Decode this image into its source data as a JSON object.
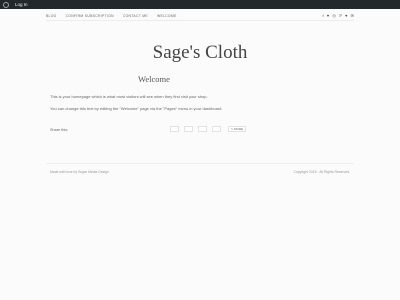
{
  "adminbar": {
    "login_label": "Log In"
  },
  "nav": {
    "items": [
      {
        "label": "BLOG"
      },
      {
        "label": "CONFIRM SUBSCRIPTION"
      },
      {
        "label": "CONTACT ME"
      },
      {
        "label": "WELCOME"
      }
    ],
    "social": [
      {
        "glyph": "f",
        "icon": "facebook-icon"
      },
      {
        "glyph": "♥",
        "icon": "twitter-icon"
      },
      {
        "glyph": "◎",
        "icon": "instagram-icon"
      },
      {
        "glyph": "ℙ",
        "icon": "pinterest-icon"
      },
      {
        "glyph": "♥",
        "icon": "bloglovin-icon"
      },
      {
        "glyph": "✉",
        "icon": "email-icon"
      }
    ]
  },
  "site": {
    "title": "Sage's Cloth"
  },
  "page": {
    "title": "Welcome",
    "paragraphs": [
      "This is your homepage which is what most visitors will see when they first visit your shop.",
      "You can change this text by editing the \"Welcome\" page via the \"Pages\" menu in your dashboard."
    ]
  },
  "share": {
    "label": "Share this:",
    "more_label": "MORE",
    "more_icon": "share-icon"
  },
  "footer": {
    "made_prefix": "Made with love by",
    "made_link": "Sugar Media Design",
    "copyright": "Copyright 2015 · All Rights Reserved."
  }
}
